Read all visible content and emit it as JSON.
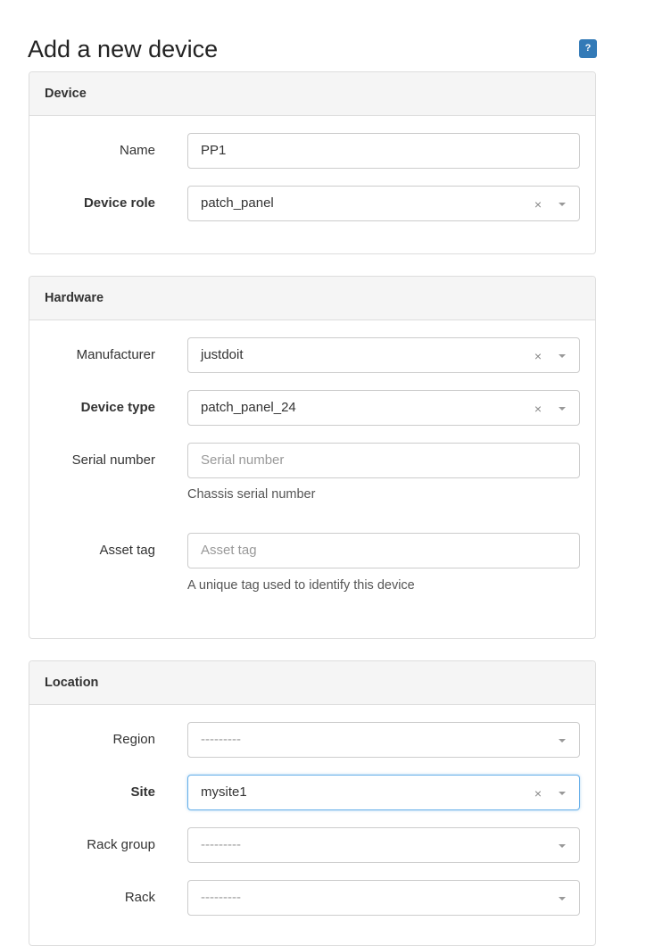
{
  "page": {
    "title": "Add a new device",
    "help_button": "?"
  },
  "device_panel": {
    "heading": "Device",
    "name": {
      "label": "Name",
      "value": "PP1"
    },
    "device_role": {
      "label": "Device role",
      "value": "patch_panel"
    }
  },
  "hardware_panel": {
    "heading": "Hardware",
    "manufacturer": {
      "label": "Manufacturer",
      "value": "justdoit"
    },
    "device_type": {
      "label": "Device type",
      "value": "patch_panel_24"
    },
    "serial_number": {
      "label": "Serial number",
      "placeholder": "Serial number",
      "help": "Chassis serial number"
    },
    "asset_tag": {
      "label": "Asset tag",
      "placeholder": "Asset tag",
      "help": "A unique tag used to identify this device"
    }
  },
  "location_panel": {
    "heading": "Location",
    "region": {
      "label": "Region",
      "value": "---------"
    },
    "site": {
      "label": "Site",
      "value": "mysite1"
    },
    "rack_group": {
      "label": "Rack group",
      "value": "---------"
    },
    "rack": {
      "label": "Rack",
      "value": "---------"
    }
  },
  "icons": {
    "clear": "×",
    "help": "question-mark",
    "dropdown": "caret-down"
  },
  "colors": {
    "help_button_bg": "#337ab7",
    "panel_heading_bg": "#f5f5f5",
    "focus_border": "#66afe9"
  }
}
